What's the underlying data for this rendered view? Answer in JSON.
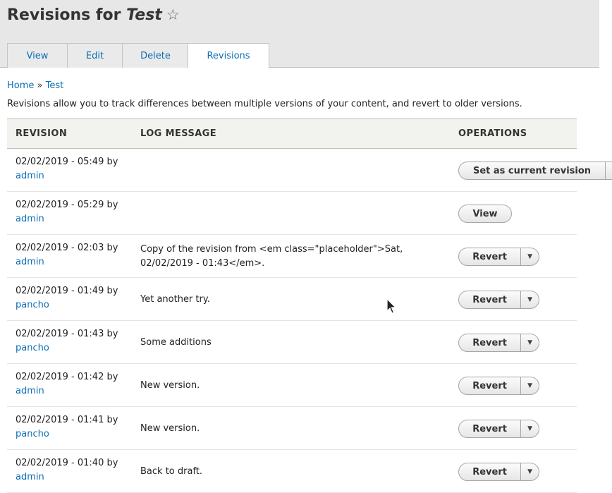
{
  "header": {
    "title_prefix": "Revisions for ",
    "title_node": "Test",
    "star_glyph": "☆"
  },
  "tabs": [
    {
      "label": "View",
      "active": false
    },
    {
      "label": "Edit",
      "active": false
    },
    {
      "label": "Delete",
      "active": false
    },
    {
      "label": "Revisions",
      "active": true
    }
  ],
  "breadcrumb": {
    "home": "Home",
    "separator": "»",
    "current": "Test"
  },
  "description": "Revisions allow you to track differences between multiple versions of your content, and revert to older versions.",
  "table": {
    "headers": {
      "revision": "REVISION",
      "log": "LOG MESSAGE",
      "operations": "OPERATIONS"
    },
    "rows": [
      {
        "date": "02/02/2019 - 05:49 by",
        "user": "admin",
        "log": "",
        "operation": "Set as current revision"
      },
      {
        "date": "02/02/2019 - 05:29 by",
        "user": "admin",
        "log": "",
        "operation": "View"
      },
      {
        "date": "02/02/2019 - 02:03 by",
        "user": "admin",
        "log": "Copy of the revision from <em class=\"placeholder\">Sat, 02/02/2019 - 01:43</em>.",
        "operation": "Revert"
      },
      {
        "date": "02/02/2019 - 01:49 by",
        "user": "pancho",
        "log": "Yet another try.",
        "operation": "Revert"
      },
      {
        "date": "02/02/2019 - 01:43 by",
        "user": "pancho",
        "log": "Some additions",
        "operation": "Revert"
      },
      {
        "date": "02/02/2019 - 01:42 by",
        "user": "admin",
        "log": "New version.",
        "operation": "Revert"
      },
      {
        "date": "02/02/2019 - 01:41 by",
        "user": "pancho",
        "log": "New version.",
        "operation": "Revert"
      },
      {
        "date": "02/02/2019 - 01:40 by",
        "user": "admin",
        "log": "Back to draft.",
        "operation": "Revert"
      }
    ]
  },
  "icons": {
    "dropdown": "chevron-down-icon",
    "favorite": "star-icon",
    "cursor": "mouse-pointer-icon"
  },
  "colors": {
    "link": "#0a6eb4",
    "header_bg": "#e7e7e7",
    "table_head_bg": "#f2f2ef"
  }
}
